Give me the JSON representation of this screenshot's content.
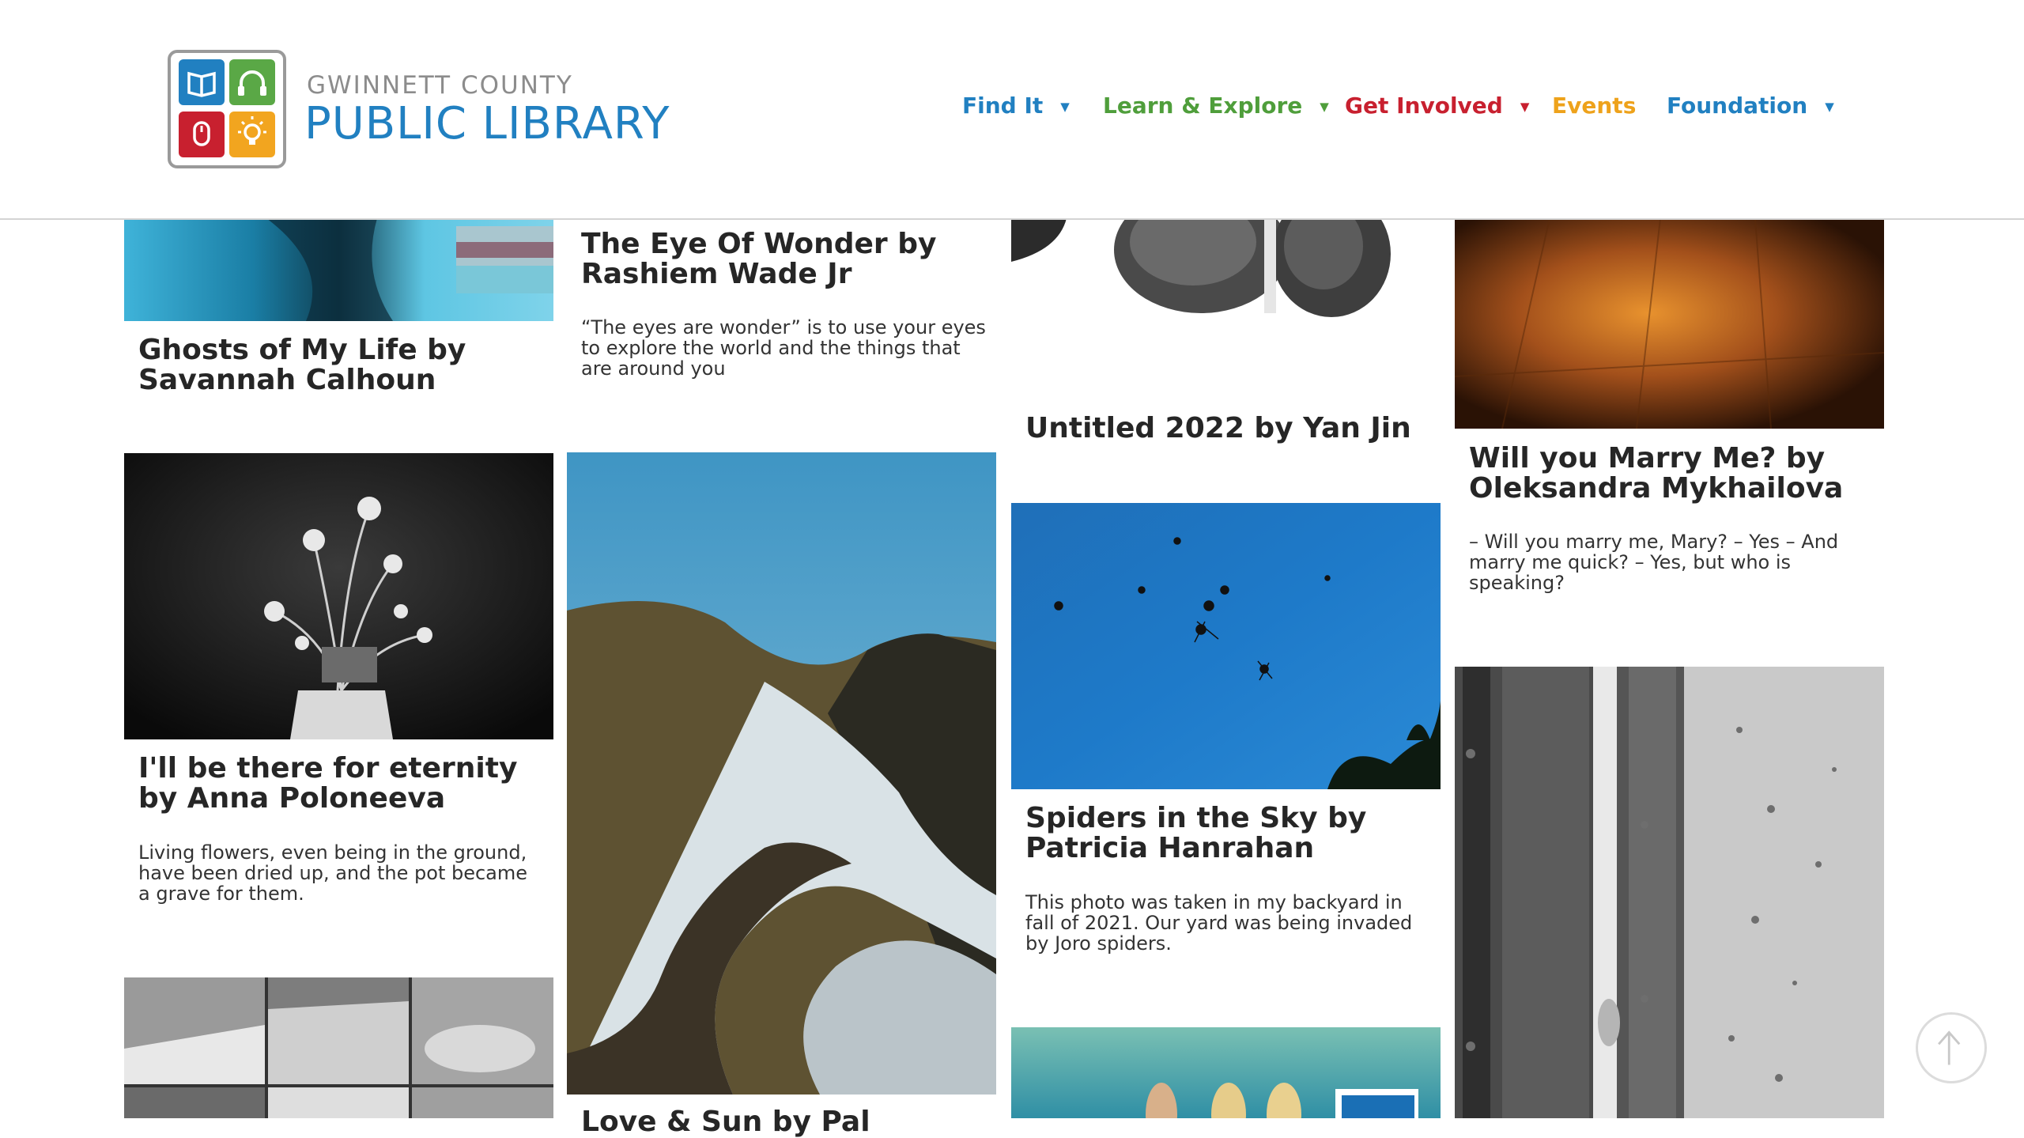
{
  "header": {
    "logo": {
      "county": "GWINNETT COUNTY",
      "library": "PUBLIC LIBRARY",
      "tile_colors": [
        "#2180c1",
        "#5aa846",
        "#c8202f",
        "#f2a51f"
      ]
    },
    "nav": [
      {
        "label": "Find It",
        "color": "#2180c1",
        "has_menu": true
      },
      {
        "label": "Learn & Explore",
        "color": "#4f9e3b",
        "has_menu": true
      },
      {
        "label": "Get Involved",
        "color": "#c8202f",
        "has_menu": true
      },
      {
        "label": "Events",
        "color": "#eea21b",
        "has_menu": false
      },
      {
        "label": "Foundation",
        "color": "#2180c1",
        "has_menu": true
      }
    ],
    "caret_glyph": "▼"
  },
  "cards": [
    {
      "title": "Ghosts of My Life by Savannah Calhoun",
      "desc": ""
    },
    {
      "title": "The Eye Of Wonder by Rashiem Wade Jr",
      "desc": "“The eyes are wonder” is to use your eyes to explore the world and the things that are around you"
    },
    {
      "title": "Untitled 2022 by Yan Jin",
      "desc": ""
    },
    {
      "title": "Will you Marry Me? by Oleksandra Mykhailova",
      "desc": "– Will you marry me, Mary? – Yes – And marry me quick? – Yes, but who is speaking?"
    },
    {
      "title": "I'll be there for eternity by Anna Poloneeva",
      "desc": "Living flowers, even being in the ground, have been dried up, and the pot became a grave for them."
    },
    {
      "title": "Spiders in the Sky by Patricia Hanrahan",
      "desc": "This photo was taken in my backyard in fall of 2021. Our yard was being invaded by Joro spiders."
    },
    {
      "title": "Love & Sun by Pal",
      "desc": ""
    }
  ],
  "scroll_top_icon": "arrow-up-icon"
}
